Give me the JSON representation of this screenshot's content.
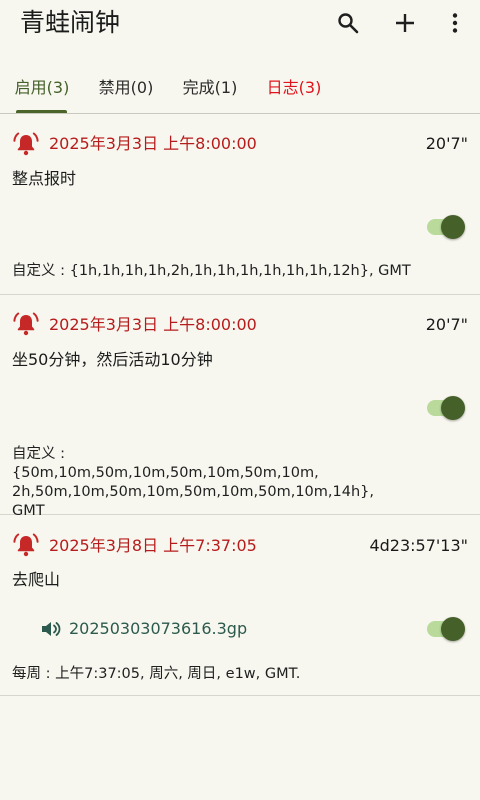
{
  "app": {
    "title": "青蛙闹钟",
    "icons": [
      "search-icon",
      "add-icon",
      "more-vert-icon"
    ]
  },
  "tabs": [
    {
      "label": "启用(3)",
      "active": true
    },
    {
      "label": "禁用(0)",
      "active": false
    },
    {
      "label": "完成(1)",
      "active": false
    },
    {
      "label": "日志(3)",
      "active": false
    }
  ],
  "colors": {
    "accent": "#4a6429",
    "alarm_time": "#b71c1c",
    "log_tab": "#e0141c",
    "sound_file": "#2d5a4e",
    "background": "#f7f7ef"
  },
  "alarms": [
    {
      "time": "2025年3月3日 上午8:00:00",
      "remaining": "20'7\"",
      "label": "整点报时",
      "enabled": true,
      "schedule": "自定义 : {1h,1h,1h,1h,2h,1h,1h,1h,1h,1h,1h,12h}, GMT"
    },
    {
      "time": "2025年3月3日 上午8:00:00",
      "remaining": "20'7\"",
      "label": "坐50分钟，然后活动10分钟",
      "enabled": true,
      "schedule": "自定义 : {50m,10m,50m,10m,50m,10m,50m,10m, 2h,50m,10m,50m,10m,50m,10m,50m,10m,14h}, GMT"
    },
    {
      "time": "2025年3月8日 上午7:37:05",
      "remaining": "4d23:57'13\"",
      "label": "去爬山",
      "enabled": true,
      "sound": "20250303073616.3gp",
      "schedule": "每周 : 上午7:37:05, 周六, 周日, e1w, GMT."
    }
  ]
}
